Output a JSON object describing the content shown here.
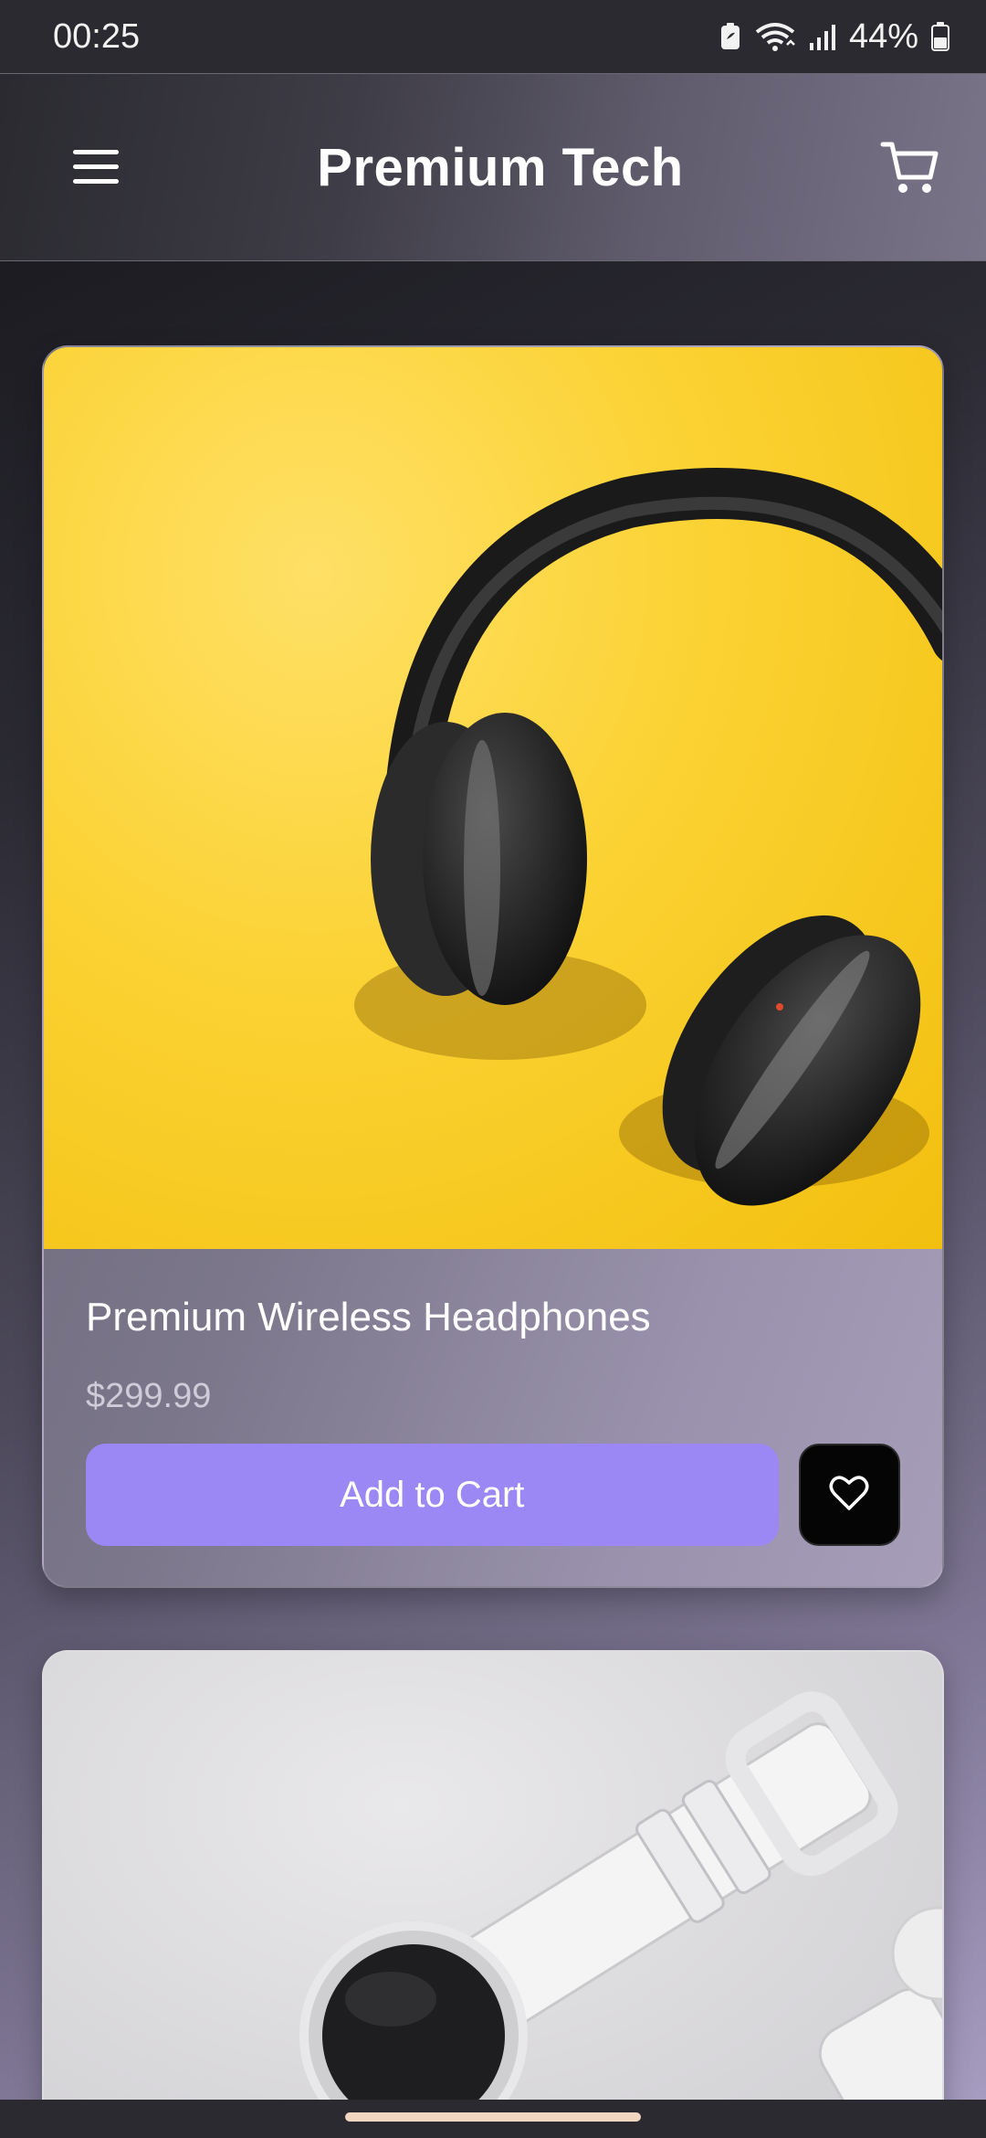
{
  "status_bar": {
    "time": "00:25",
    "battery_percent": "44%",
    "icons": [
      "battery-saver-icon",
      "wifi-icon",
      "signal-icon",
      "battery-icon"
    ]
  },
  "app_bar": {
    "title": "Premium Tech",
    "menu_icon": "hamburger-menu-icon",
    "cart_icon": "shopping-cart-icon"
  },
  "products": [
    {
      "name": "Premium Wireless Headphones",
      "price": "$299.99",
      "add_label": "Add to Cart",
      "image": "headphones-photo",
      "favorite_icon": "heart-outline-icon"
    },
    {
      "image": "smartwatch-photo"
    }
  ],
  "colors": {
    "accent": "#9b88f4",
    "app_bar": "#2a2a30",
    "headphone_bg": "#fbd232"
  }
}
